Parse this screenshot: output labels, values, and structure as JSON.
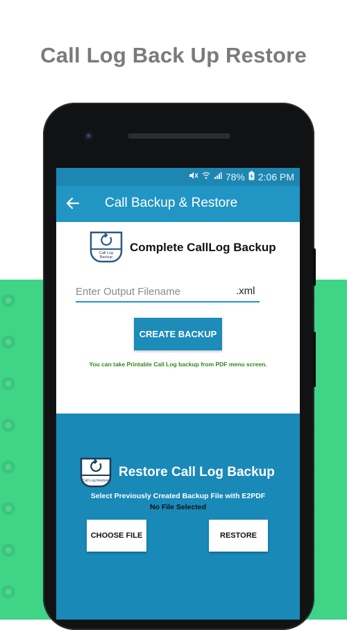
{
  "promo": {
    "title": "Call Log Back Up Restore"
  },
  "status_bar": {
    "battery": "78%",
    "time": "2:06 PM"
  },
  "app_bar": {
    "title": "Call Backup & Restore"
  },
  "backup": {
    "heading": "Complete CallLog Backup",
    "icon_label_line1": "Call Log",
    "icon_label_line2": "Backup",
    "filename_placeholder": "Enter Output Filename",
    "filename_value": "",
    "extension": ".xml",
    "create_label": "CREATE BACKUP",
    "hint": "You can take Printable Call Log backup from PDF menu screen."
  },
  "restore": {
    "heading": "Restore Call Log Backup",
    "icon_label": "Call Log Restore",
    "instruction": "Select Previously Created Backup File with E2PDF",
    "selected_file": "No File Selected",
    "choose_label": "CHOOSE FILE",
    "restore_label": "RESTORE"
  },
  "colors": {
    "primary": "#2196c4",
    "primary_dark": "#1d87b2",
    "restore_bg": "#1989b8",
    "hint_green": "#2e8a14",
    "band_green": "#3fd486"
  }
}
